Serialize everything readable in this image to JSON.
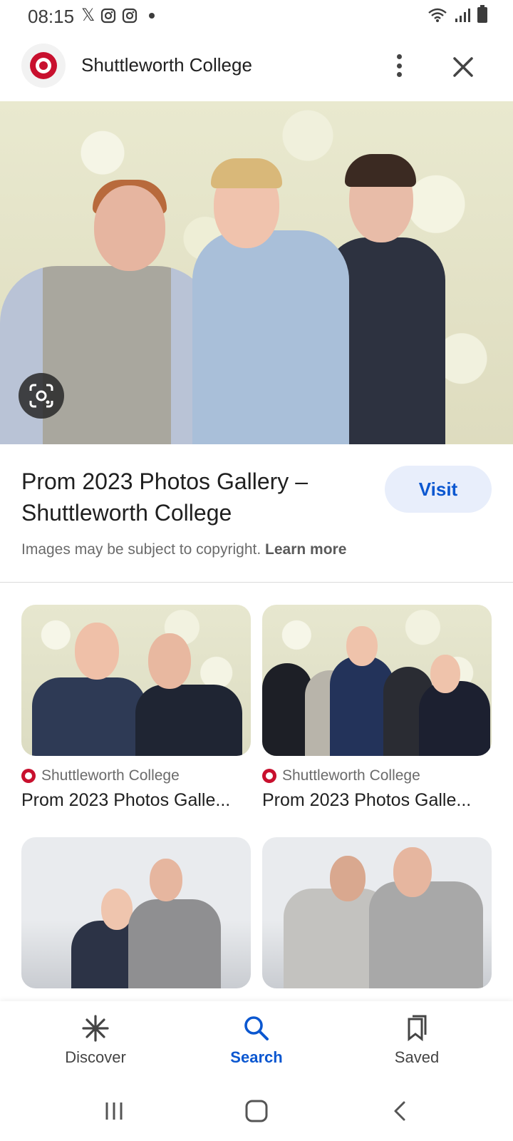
{
  "status_bar": {
    "time": "08:15",
    "left_icons": [
      "x-icon",
      "instagram-icon",
      "instagram-icon",
      "dot-icon"
    ],
    "right_icons": [
      "wifi-icon",
      "signal-icon",
      "battery-icon"
    ]
  },
  "header": {
    "site_name": "Shuttleworth College",
    "logo_icon": "rose-logo-icon",
    "more_icon": "more-vert-icon",
    "close_icon": "close-icon"
  },
  "hero": {
    "lens_icon": "lens-icon"
  },
  "result": {
    "title": "Prom 2023 Photos Gallery – Shuttleworth College",
    "visit_label": "Visit",
    "copyright_text": "Images may be subject to copyright.",
    "learn_more_label": "Learn more"
  },
  "related": [
    {
      "source": "Shuttleworth College",
      "title": "Prom 2023 Photos Galle..."
    },
    {
      "source": "Shuttleworth College",
      "title": "Prom 2023 Photos Galle..."
    },
    {
      "source": "",
      "title": ""
    },
    {
      "source": "",
      "title": ""
    }
  ],
  "bottom_nav": {
    "items": [
      {
        "label": "Discover",
        "icon": "asterisk-icon",
        "active": false
      },
      {
        "label": "Search",
        "icon": "search-icon",
        "active": true
      },
      {
        "label": "Saved",
        "icon": "bookmarks-icon",
        "active": false
      }
    ]
  },
  "system_nav": {
    "recents_icon": "recents-icon",
    "home_icon": "home-icon",
    "back_icon": "back-icon"
  },
  "colors": {
    "accent": "#0b57d0",
    "visit_bg": "#e8eefb",
    "brand_red": "#c8102e"
  }
}
